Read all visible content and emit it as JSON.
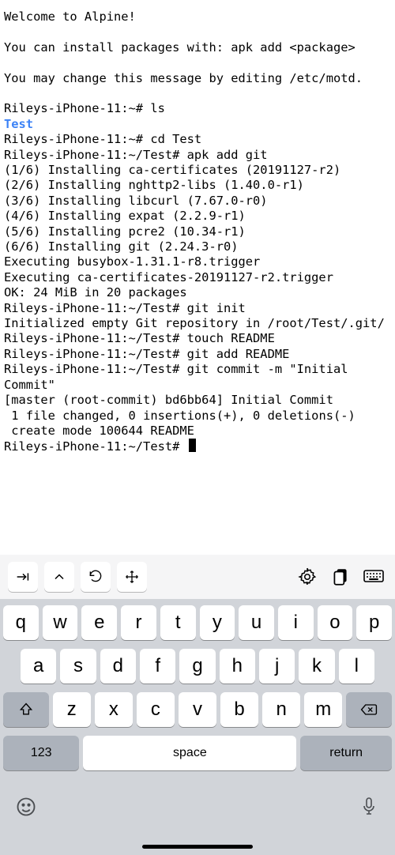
{
  "terminal": {
    "welcome": "Welcome to Alpine!",
    "install_hint": "You can install packages with: apk add <package>",
    "motd_hint": "You may change this message by editing /etc/motd.",
    "lines": [
      {
        "prompt": "Rileys-iPhone-11:~# ",
        "cmd": "ls"
      },
      {
        "output_dir": "Test"
      },
      {
        "prompt": "Rileys-iPhone-11:~# ",
        "cmd": "cd Test"
      },
      {
        "prompt": "Rileys-iPhone-11:~/Test# ",
        "cmd": "apk add git"
      },
      {
        "output": "(1/6) Installing ca-certificates (20191127-r2)"
      },
      {
        "output": "(2/6) Installing nghttp2-libs (1.40.0-r1)"
      },
      {
        "output": "(3/6) Installing libcurl (7.67.0-r0)"
      },
      {
        "output": "(4/6) Installing expat (2.2.9-r1)"
      },
      {
        "output": "(5/6) Installing pcre2 (10.34-r1)"
      },
      {
        "output": "(6/6) Installing git (2.24.3-r0)"
      },
      {
        "output": "Executing busybox-1.31.1-r8.trigger"
      },
      {
        "output": "Executing ca-certificates-20191127-r2.trigger"
      },
      {
        "output": "OK: 24 MiB in 20 packages"
      },
      {
        "prompt": "Rileys-iPhone-11:~/Test# ",
        "cmd": "git init"
      },
      {
        "output": "Initialized empty Git repository in /root/Test/.git/"
      },
      {
        "prompt": "Rileys-iPhone-11:~/Test# ",
        "cmd": "touch README"
      },
      {
        "prompt": "Rileys-iPhone-11:~/Test# ",
        "cmd": "git add README"
      },
      {
        "prompt": "Rileys-iPhone-11:~/Test# ",
        "cmd": "git commit -m \"Initial Commit\""
      },
      {
        "output": "[master (root-commit) bd6bb64] Initial Commit"
      },
      {
        "output": " 1 file changed, 0 insertions(+), 0 deletions(-)"
      },
      {
        "output": " create mode 100644 README"
      },
      {
        "prompt": "Rileys-iPhone-11:~/Test# ",
        "cursor": true
      }
    ]
  },
  "keyboard": {
    "row1": [
      "q",
      "w",
      "e",
      "r",
      "t",
      "y",
      "u",
      "i",
      "o",
      "p"
    ],
    "row2": [
      "a",
      "s",
      "d",
      "f",
      "g",
      "h",
      "j",
      "k",
      "l"
    ],
    "row3": [
      "z",
      "x",
      "c",
      "v",
      "b",
      "n",
      "m"
    ],
    "numkey": "123",
    "space": "space",
    "return": "return"
  }
}
